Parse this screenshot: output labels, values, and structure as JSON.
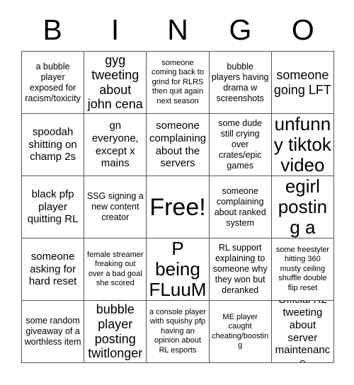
{
  "card": {
    "title": "BINGO",
    "header_letters": [
      "B",
      "I",
      "N",
      "G",
      "O"
    ],
    "grid_size": 5,
    "free_space_label": "Free!",
    "colors": {
      "background": "#ffffff",
      "text": "#000000",
      "grid_line": "#555555"
    },
    "rows": [
      [
        {
          "text": "a bubble player exposed for racism/toxicity",
          "size": "sm"
        },
        {
          "text": "gyg tweeting about john cena",
          "size": "lg"
        },
        {
          "text": "someone coming back to grind for RLRS then quit again next season",
          "size": "xs"
        },
        {
          "text": "bubble players having drama w screenshots",
          "size": "sm"
        },
        {
          "text": "someone going LFT",
          "size": "lg"
        }
      ],
      [
        {
          "text": "spoodah shitting on champ 2s",
          "size": "md"
        },
        {
          "text": "gn everyone, except x mains",
          "size": "md"
        },
        {
          "text": "someone complaining about the servers",
          "size": "md"
        },
        {
          "text": "some dude still crying over crates/epic games",
          "size": "sm"
        },
        {
          "text": "unfunny tiktok video",
          "size": "xl"
        }
      ],
      [
        {
          "text": "black pfp player quitting RL",
          "size": "md"
        },
        {
          "text": "SSG signing a new content creator",
          "size": "sm"
        },
        {
          "text": "Free!",
          "size": "free"
        },
        {
          "text": "someone complaining about ranked system",
          "size": "sm"
        },
        {
          "text": "RL egirl posting a selfie",
          "size": "xl"
        }
      ],
      [
        {
          "text": "someone asking for hard reset",
          "size": "md"
        },
        {
          "text": "female streamer freaking out over a bad goal she scored",
          "size": "xs"
        },
        {
          "text": "FLuuMP being FLuuMP",
          "size": "xl"
        },
        {
          "text": "RL support explaining to someone why they won but deranked",
          "size": "sm"
        },
        {
          "text": "some freestyler hitting 360 musty ceiling shuffle double flip reset",
          "size": "xs"
        }
      ],
      [
        {
          "text": "some random giveaway of a worthless item",
          "size": "sm"
        },
        {
          "text": "bubble player posting twitlonger",
          "size": "lg"
        },
        {
          "text": "a console player with squishy pfp having an opinion about RL esports",
          "size": "xs"
        },
        {
          "text": "ME player caught cheating/boosting",
          "size": "xs"
        },
        {
          "text": "Official RL tweeting about server maintenance",
          "size": "md"
        }
      ]
    ]
  }
}
